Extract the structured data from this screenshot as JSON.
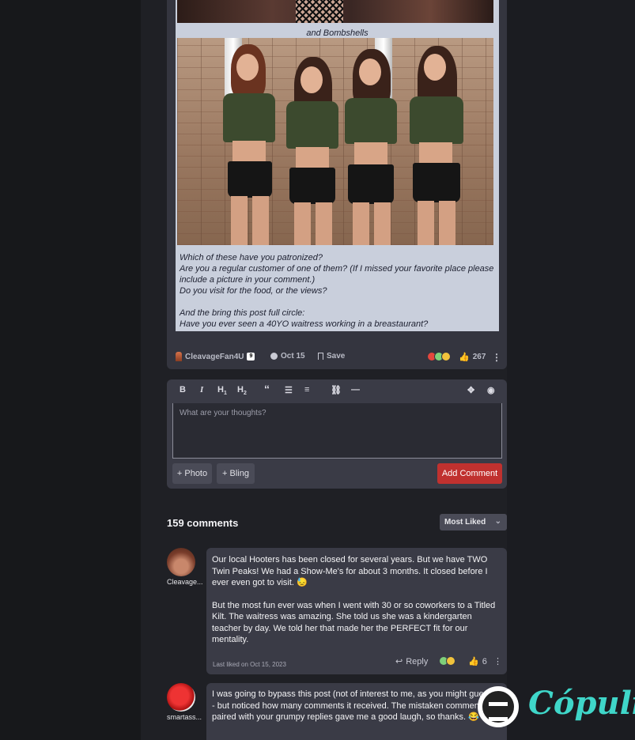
{
  "post": {
    "caption": "and Bombshells",
    "body_lines": "Which of these have you patronized?\nAre you a regular customer of one of them? (If I missed your favorite place please include a picture in your comment.)\nDo you visit for the food, or the views?\n\nAnd the bring this post full circle:\nHave you ever seen a 40YO waitress working in a breastaurant?",
    "author": "CleavageFan4U",
    "author_badge": "9",
    "date": "Oct 15",
    "save_label": "Save",
    "like_count": "267",
    "icons": {
      "author": "author-flair-icon",
      "date": "clock-icon",
      "save": "bookmark-icon",
      "likes": "thumbs-up-icon",
      "menu": "kebab-menu-icon"
    }
  },
  "editor": {
    "placeholder": "What are your thoughts?",
    "toolbar": [
      "B",
      "I",
      "H1",
      "H2",
      "“",
      "list",
      "ordered-list",
      "link",
      "—",
      "move",
      "preview"
    ],
    "photo_label": "Photo",
    "bling_label": "Bling",
    "submit_label": "Add Comment"
  },
  "comments_header": {
    "count_label": "159 comments",
    "sort_label": "Most Liked"
  },
  "comments": [
    {
      "user": "Cleavage...",
      "paragraphs": [
        "Our local Hooters has been closed for several years. But we have TWO Twin Peaks! We had a Show-Me's for about 3 months. It closed before I ever even got to visit. 😓",
        "But the most fun ever was when I went with 30 or so coworkers to a Titled Kilt. The waitress was amazing. She told us she was a kindergarten teacher by day. We told her that made her the PERFECT fit for our mentality."
      ],
      "last_liked": "Last liked on Oct 15, 2023",
      "reply_label": "Reply",
      "likes": "6"
    },
    {
      "user": "smartass...",
      "paragraphs": [
        "I was going to bypass this post (not of interest to me, as you might guess) - but noticed how many comments it received. The mistaken comments paired with your grumpy replies gave me a good laugh, so thanks. 😂"
      ]
    }
  ],
  "watermark": {
    "brand": "Cópuli",
    "accent": "#3fd6c9"
  },
  "colors": {
    "add_button": "#c0312f",
    "card": "#34353f",
    "post_body": "#c9cfdc"
  }
}
